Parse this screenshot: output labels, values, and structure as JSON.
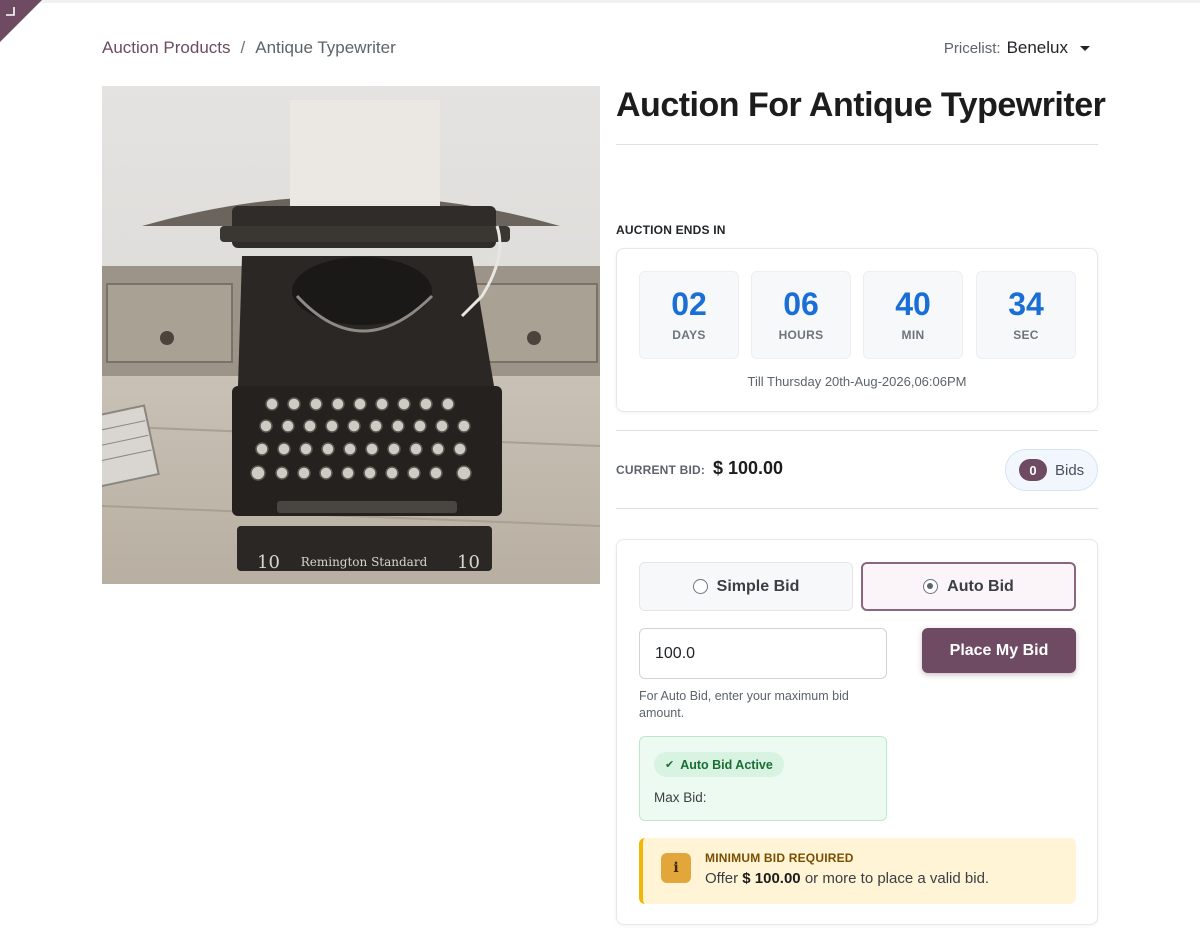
{
  "breadcrumb": {
    "parent": "Auction Products",
    "separator": "/",
    "current": "Antique Typewriter"
  },
  "pricelist": {
    "label": "Pricelist:",
    "value": "Benelux"
  },
  "product": {
    "title": "Auction For Antique Typewriter",
    "image_label": "Remington Standard",
    "image_number": "10"
  },
  "countdown": {
    "heading": "AUCTION ENDS IN",
    "days": "02",
    "days_label": "DAYS",
    "hours": "06",
    "hours_label": "HOURS",
    "minutes": "40",
    "minutes_label": "MIN",
    "seconds": "34",
    "seconds_label": "SEC",
    "till": "Till Thursday 20th-Aug-2026,06:06PM"
  },
  "current_bid": {
    "label": "CURRENT BID:",
    "value": "$ 100.00",
    "bid_count": "0",
    "bids_label": "Bids"
  },
  "bid_form": {
    "simple_label": "Simple Bid",
    "auto_label": "Auto Bid",
    "selected_mode": "Auto Bid",
    "amount_value": "100.0",
    "place_label": "Place My Bid",
    "help_text": "For Auto Bid, enter your maximum bid amount.",
    "auto_active_label": "Auto Bid Active",
    "max_bid_label": "Max Bid:"
  },
  "minimum_bid": {
    "title": "MINIMUM BID REQUIRED",
    "prefix": "Offer",
    "amount": "$ 100.00",
    "suffix": "or more to place a valid bid.",
    "icon_char": "i"
  },
  "colors": {
    "brand": "#6e4a63",
    "countdown_numbers": "#1a6fd6",
    "success_bg": "#edfaf1",
    "warning_bg": "#fff4d6",
    "warning_border": "#f2b705"
  }
}
